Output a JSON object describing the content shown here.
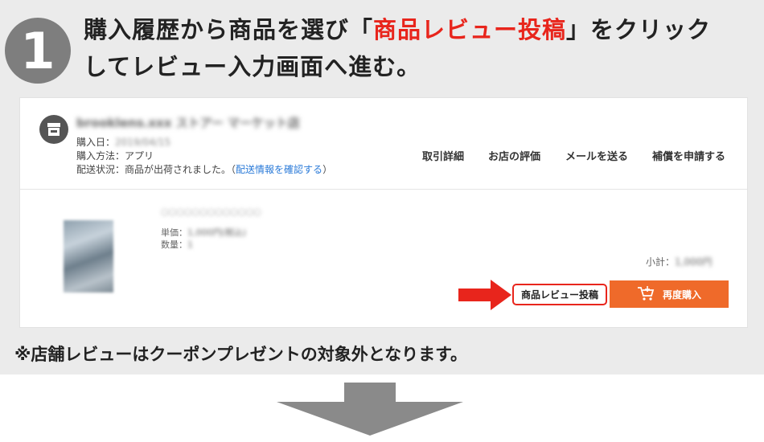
{
  "step": {
    "number": "1"
  },
  "heading": {
    "pre": "購入履歴から商品を選び「",
    "highlight": "商品レビュー投稿",
    "post": "」をクリック",
    "line2": "してレビュー入力画面へ進む。"
  },
  "order": {
    "shop_name": "brooklens.xxx ストアー マーケット店",
    "purchase_date_label": "購入日：",
    "purchase_date_value": "2019/04/15",
    "method_label": "購入方法：",
    "method_value": "アプリ",
    "shipping_label": "配送状況：",
    "shipping_value": "商品が出荷されました。",
    "shipping_link_open": "（",
    "shipping_link": "配送情報を確認する",
    "shipping_link_close": "）",
    "actions": [
      "取引詳細",
      "お店の評価",
      "メールを送る",
      "補償を申請する"
    ]
  },
  "product": {
    "title": "○○○○○○○○○○○○○",
    "unit_price_label": "単価：",
    "unit_price_value": "1,000円(税込)",
    "qty_label": "数量：",
    "qty_value": "1",
    "subtotal_label": "小計：",
    "subtotal_value": "1,000円",
    "review_button": "商品レビュー投稿",
    "rebuy_button": "再度購入"
  },
  "note": "※店舗レビューはクーポンプレゼントの対象外となります。",
  "colors": {
    "accent_red": "#e8251c",
    "rebuy_orange": "#ef6a2a",
    "panel_gray": "#ebebeb"
  },
  "icons": [
    "shop-icon",
    "cart-icon",
    "red-arrow-icon",
    "down-arrow-icon"
  ]
}
